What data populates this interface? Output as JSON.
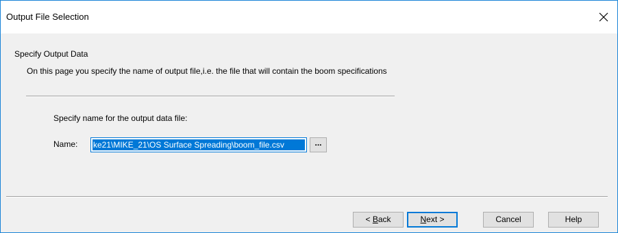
{
  "window": {
    "title": "Output File Selection",
    "close_glyph": "✕",
    "close_icon": "close-icon"
  },
  "page": {
    "heading": "Specify Output Data",
    "description": "On this page you specify the name of output file,i.e. the file that will contain the boom specifications",
    "prompt": "Specify name for the output data file:"
  },
  "output_file": {
    "label": "Name:",
    "value": "ke21\\MIKE_21\\OS Surface Spreading\\boom_file.csv",
    "selected": true,
    "browse_label": "..."
  },
  "buttons": {
    "back_prefix": "< ",
    "back_mnemonic": "B",
    "back_rest": "ack",
    "next_mnemonic": "N",
    "next_rest": "ext >",
    "cancel": "Cancel",
    "help": "Help"
  },
  "colors": {
    "window_border": "#1883d7",
    "dialog_bg": "#f0f0f0",
    "selection": "#0078d7",
    "button_bg": "#e1e1e1"
  }
}
